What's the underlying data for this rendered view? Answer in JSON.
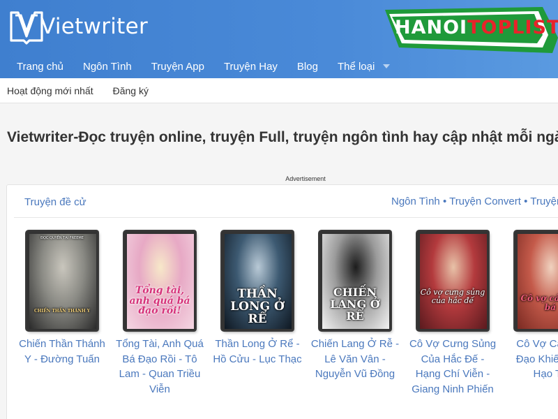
{
  "site": {
    "name": "Vietwriter"
  },
  "nav": {
    "items": [
      "Trang chủ",
      "Ngôn Tình",
      "Truyện App",
      "Truyện Hay",
      "Blog",
      "Thể loại"
    ]
  },
  "watermark": {
    "part1": "HANOI",
    "part2": "TOPLIST"
  },
  "subnav": {
    "items": [
      "Hoạt động mới nhất",
      "Đăng ký"
    ]
  },
  "tagline": "Vietwriter-Đọc truyện online, truyện Full, truyện ngôn tình hay cập nhật mỗi ngày",
  "ad_label": "Advertisement",
  "featured": {
    "title": "Truyện đề cử",
    "links": "Ngôn Tình • Truyện Convert • Truyện",
    "books": [
      {
        "title": "Chiến Thần Thánh Y - Đường Tuấn",
        "cover_text": "CHIẾN THẦN THÁNH Y",
        "cover_top_text": "ĐỌC QUYỀN TẠI FREEME",
        "colors": [
          "#2a2a2a",
          "#8a8a84",
          "#c9c6bd"
        ]
      },
      {
        "title": "Tổng Tài, Anh Quá Bá Đạo Rồi - Tô Lam - Quan Triều Viễn",
        "cover_text": "Tổng tài, anh quá bá đạo rồi!",
        "colors": [
          "#f4d6e2",
          "#e7a9c5",
          "#f7e8c9"
        ]
      },
      {
        "title": "Thần Long Ở Rể - Hồ Cửu - Lục Thạc",
        "cover_text": "THẦN LONG Ở RỂ",
        "colors": [
          "#0f1822",
          "#3d5a72",
          "#b8c9d6"
        ]
      },
      {
        "title": "Chiến Lang Ở Rễ - Lê Văn Vân - Nguyễn Vũ Đồng",
        "cover_text": "CHIẾN LANG Ở RỂ",
        "colors": [
          "#f2f2f2",
          "#9a9a9a",
          "#1c1c1c"
        ]
      },
      {
        "title": "Cô Vợ Cưng Sủng Của Hắc Đế - Hạng Chí Viễn - Giang Ninh Phiến",
        "cover_text": "Cô vợ cưng sủng của hắc đế",
        "colors": [
          "#5a1a1e",
          "#b33a3d",
          "#e8c2a8"
        ]
      },
      {
        "title": "Cô Vợ Cân Bá Đạo Khiết - Ng Hạo Th",
        "cover_text": "Cô vợ cá quá bá",
        "colors": [
          "#7a2a22",
          "#c45a4a",
          "#f0d2bf"
        ]
      }
    ]
  },
  "colors": {
    "header": "#4a8ad8",
    "link": "#4a78bd",
    "watermark_red": "#e8232a",
    "watermark_green": "#1f9a3a"
  }
}
